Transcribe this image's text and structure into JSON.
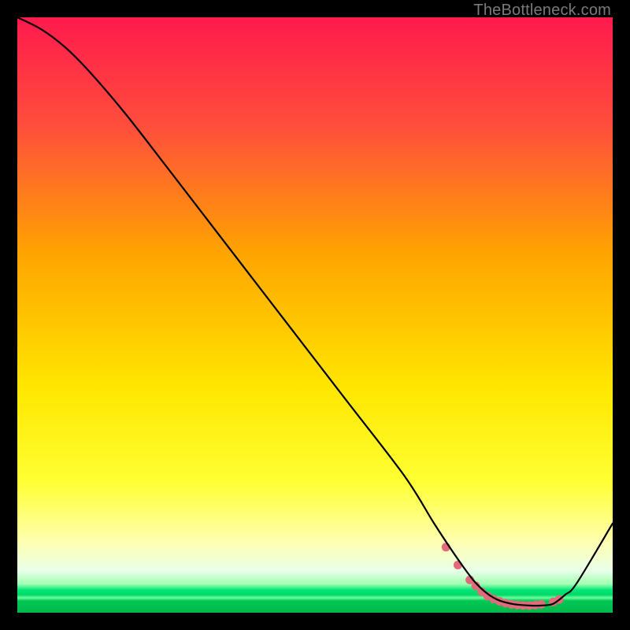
{
  "attribution": "TheBottleneck.com",
  "colors": {
    "red_top": "#ff1a4d",
    "orange": "#ffa500",
    "yellow": "#ffff1a",
    "pale_yellow": "#ffffa0",
    "green_band_top": "#b8ffb8",
    "green_band_mid": "#00e676",
    "green_band_bottom": "#00c853",
    "curve": "#000000",
    "markers": "#e16b7a",
    "frame": "#000000"
  },
  "chart_data": {
    "type": "line",
    "title": "",
    "xlabel": "",
    "ylabel": "",
    "xlim": [
      0,
      100
    ],
    "ylim": [
      0,
      100
    ],
    "curve": {
      "x": [
        0,
        4,
        8,
        12,
        18,
        25,
        35,
        45,
        55,
        65,
        70,
        74,
        77,
        80,
        83,
        86,
        88,
        90,
        92,
        94,
        100
      ],
      "y": [
        100,
        98,
        95,
        91,
        84,
        75,
        62,
        49,
        36,
        23,
        15,
        9,
        5,
        2.5,
        1.5,
        1.2,
        1.2,
        1.5,
        3,
        5,
        15
      ]
    },
    "markers": {
      "x": [
        72,
        74,
        76,
        77,
        78,
        79,
        80,
        81,
        82,
        83,
        84,
        85,
        86,
        87,
        88,
        90,
        91
      ],
      "y": [
        11,
        8,
        5.5,
        4.5,
        3.5,
        2.8,
        2.3,
        1.9,
        1.6,
        1.4,
        1.3,
        1.2,
        1.2,
        1.3,
        1.4,
        1.8,
        2.2
      ]
    }
  }
}
